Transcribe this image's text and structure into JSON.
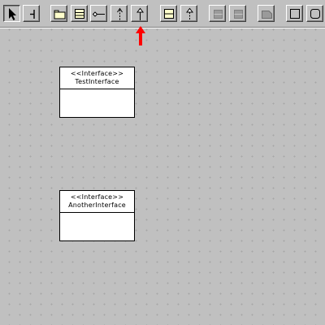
{
  "toolbar": {
    "buttons": [
      {
        "id": "select",
        "icon": "select-arrow-icon"
      },
      {
        "id": "broom",
        "icon": "broom-icon"
      },
      {
        "id": "package",
        "icon": "package-icon"
      },
      {
        "id": "class",
        "icon": "class-icon"
      },
      {
        "id": "association",
        "icon": "association-icon"
      },
      {
        "id": "dependency",
        "icon": "dependency-icon"
      },
      {
        "id": "generalization",
        "icon": "generalization-icon"
      },
      {
        "id": "interface",
        "icon": "interface-icon"
      },
      {
        "id": "realization",
        "icon": "realization-icon"
      },
      {
        "id": "disabled-1",
        "icon": "disabled-class-icon"
      },
      {
        "id": "disabled-2",
        "icon": "disabled-class-icon"
      },
      {
        "id": "note",
        "icon": "note-icon"
      },
      {
        "id": "rectangle",
        "icon": "rectangle-icon"
      },
      {
        "id": "rounded-rect",
        "icon": "rounded-rectangle-icon"
      }
    ]
  },
  "diagram": {
    "interfaces": [
      {
        "stereotype": "<<Interface>>",
        "name": "TestInterface"
      },
      {
        "stereotype": "<<Interface>>",
        "name": "AnotherInterface"
      }
    ]
  },
  "annotation": {
    "arrow_color": "#ff0000"
  },
  "colors": {
    "background": "#c0c0c0",
    "grid_dot": "#a6a6a6",
    "box_fill": "#ffffff",
    "highlight_fill": "#ffffcc"
  }
}
